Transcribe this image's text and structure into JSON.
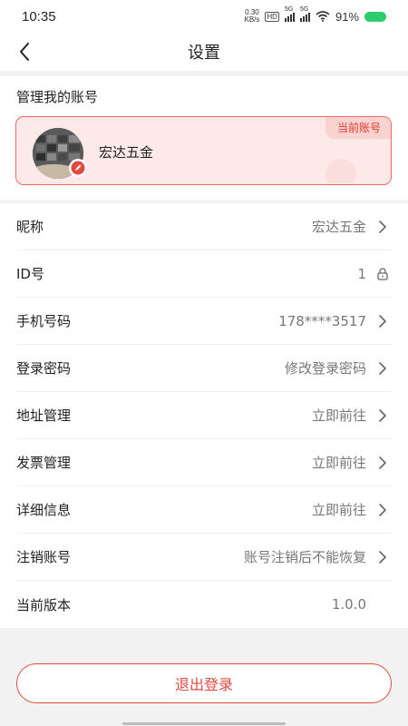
{
  "status_bar": {
    "time": "10:35",
    "net_speed_value": "0.30",
    "net_speed_unit": "KB/s",
    "hd_label": "HD",
    "sim1_label": "5G",
    "sim2_label": "5G",
    "battery_percent": "91%",
    "battery_color": "#2ecc71"
  },
  "header": {
    "title": "设置",
    "back_icon": "chevron-left-icon"
  },
  "account": {
    "section_title": "管理我的账号",
    "current_tag": "当前账号",
    "name": "宏达五金",
    "accent_color": "#e2493f"
  },
  "settings": [
    {
      "label": "昵称",
      "value": "宏达五金",
      "icon": "chevron-right-icon"
    },
    {
      "label": "ID号",
      "value": "1",
      "icon": "lock-icon"
    },
    {
      "label": "手机号码",
      "value": "178****3517",
      "icon": "chevron-right-icon"
    },
    {
      "label": "登录密码",
      "value": "修改登录密码",
      "icon": "chevron-right-icon"
    },
    {
      "label": "地址管理",
      "value": "立即前往",
      "icon": "chevron-right-icon"
    },
    {
      "label": "发票管理",
      "value": "立即前往",
      "icon": "chevron-right-icon"
    },
    {
      "label": "详细信息",
      "value": "立即前往",
      "icon": "chevron-right-icon"
    },
    {
      "label": "注销账号",
      "value": "账号注销后不能恢复",
      "icon": "chevron-right-icon"
    },
    {
      "label": "当前版本",
      "value": "1.0.0",
      "icon": ""
    }
  ],
  "logout": {
    "label": "退出登录"
  }
}
